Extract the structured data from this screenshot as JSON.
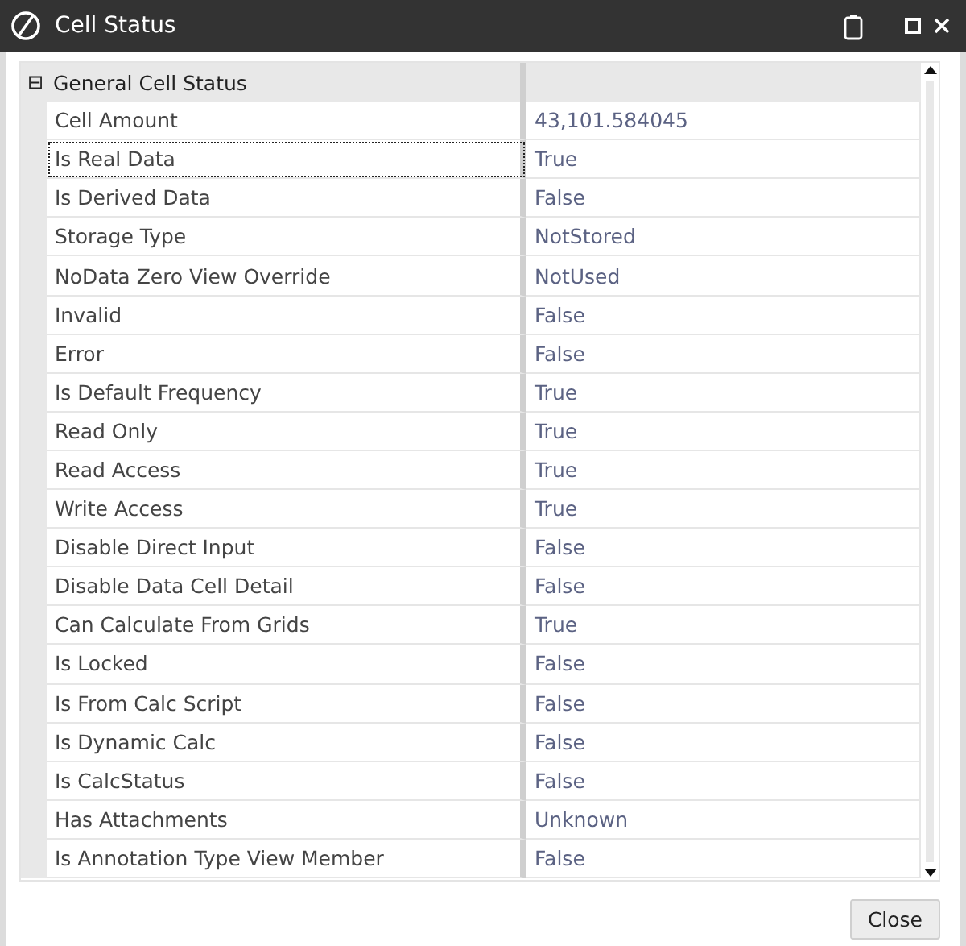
{
  "window": {
    "title": "Cell Status"
  },
  "grid": {
    "category": {
      "label": "General Cell Status",
      "expanded": true,
      "toggle": "⊟"
    },
    "rows": [
      {
        "name": "Cell Amount",
        "value": "43,101.584045",
        "focused": false
      },
      {
        "name": "Is Real Data",
        "value": "True",
        "focused": true
      },
      {
        "name": "Is Derived Data",
        "value": "False",
        "focused": false
      },
      {
        "name": "Storage Type",
        "value": "NotStored",
        "focused": false
      },
      {
        "name": "NoData Zero View Override",
        "value": "NotUsed",
        "focused": false
      },
      {
        "name": "Invalid",
        "value": "False",
        "focused": false
      },
      {
        "name": "Error",
        "value": "False",
        "focused": false
      },
      {
        "name": "Is Default Frequency",
        "value": "True",
        "focused": false
      },
      {
        "name": "Read Only",
        "value": "True",
        "focused": false
      },
      {
        "name": "Read Access",
        "value": "True",
        "focused": false
      },
      {
        "name": "Write Access",
        "value": "True",
        "focused": false
      },
      {
        "name": "Disable Direct Input",
        "value": "False",
        "focused": false
      },
      {
        "name": "Disable Data Cell Detail",
        "value": "False",
        "focused": false
      },
      {
        "name": "Can Calculate From Grids",
        "value": "True",
        "focused": false
      },
      {
        "name": "Is Locked",
        "value": "False",
        "focused": false
      },
      {
        "name": "Is From Calc Script",
        "value": "False",
        "focused": false
      },
      {
        "name": "Is Dynamic Calc",
        "value": "False",
        "focused": false
      },
      {
        "name": "Is CalcStatus",
        "value": "False",
        "focused": false
      },
      {
        "name": "Has Attachments",
        "value": "Unknown",
        "focused": false
      },
      {
        "name": "Is Annotation Type View Member",
        "value": "False",
        "focused": false
      }
    ]
  },
  "buttons": [
    {
      "label": "Close"
    }
  ]
}
